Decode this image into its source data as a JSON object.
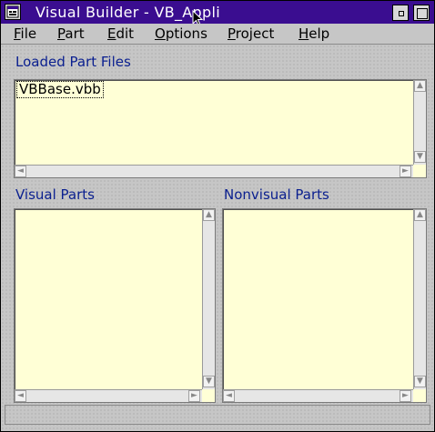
{
  "window": {
    "title": "Visual Builder - VB_Appli"
  },
  "menu": [
    {
      "label": "File"
    },
    {
      "label": "Part"
    },
    {
      "label": "Edit"
    },
    {
      "label": "Options"
    },
    {
      "label": "Project"
    },
    {
      "label": "Help"
    }
  ],
  "loaded_part_files": {
    "label": "Loaded Part Files",
    "items": [
      "VBBase.vbb"
    ]
  },
  "visual_parts": {
    "label": "Visual Parts",
    "items": []
  },
  "nonvisual_parts": {
    "label": "Nonvisual Parts",
    "items": []
  },
  "status": {
    "text": ""
  },
  "colors": {
    "title_bar": "#3a0d90",
    "listbox_bg": "#ffffd6",
    "section_label": "#0a1f8f"
  }
}
